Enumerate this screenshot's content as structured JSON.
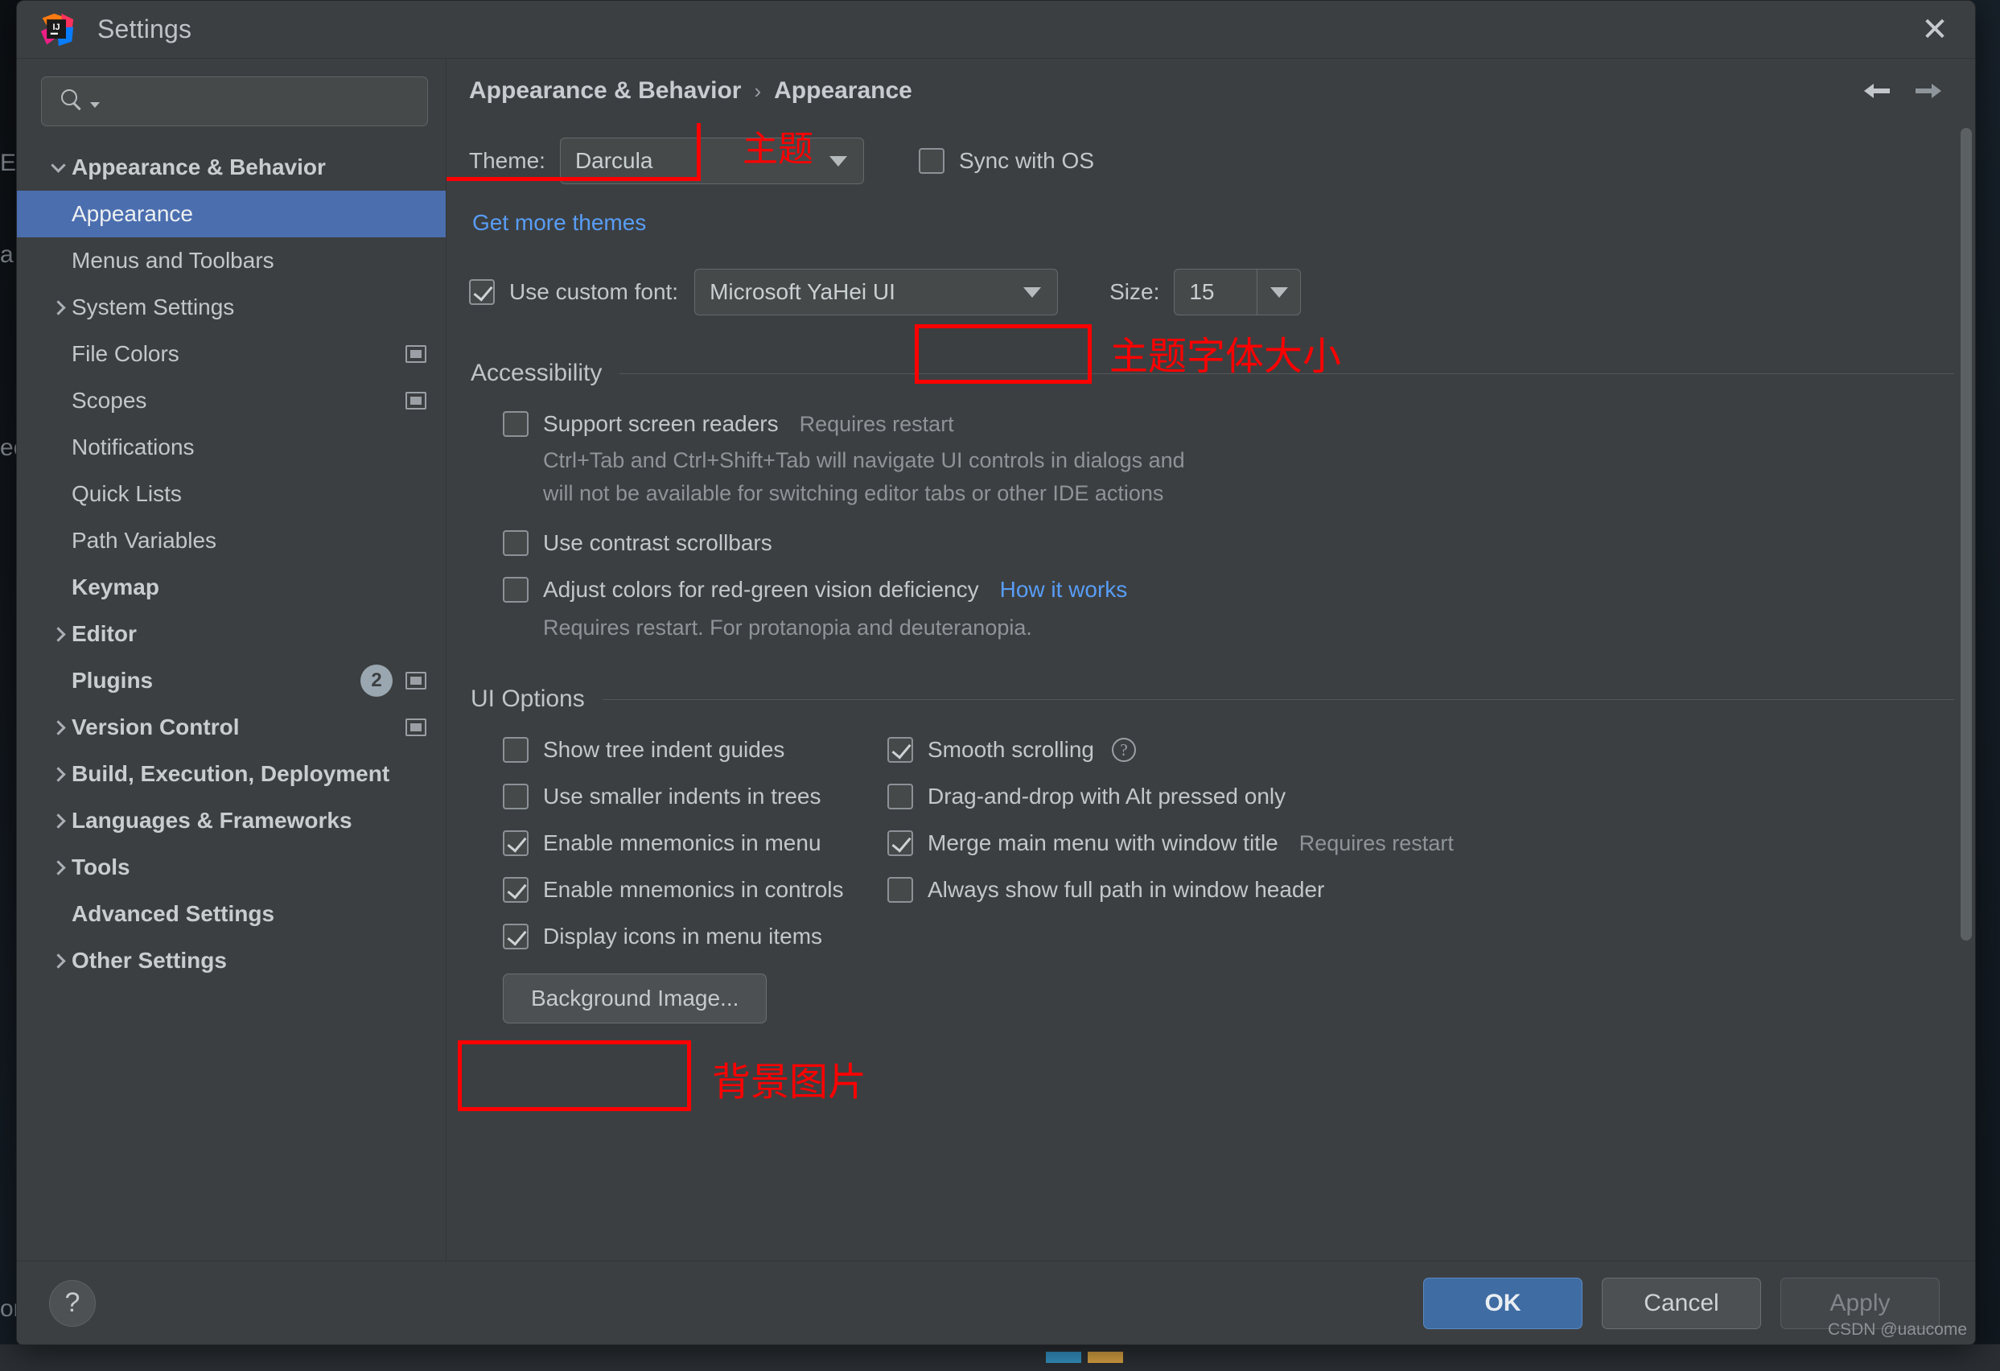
{
  "window": {
    "title": "Settings",
    "app_icon": "intellij-idea-icon",
    "close_icon": "close-icon"
  },
  "sidebar": {
    "search": {
      "placeholder": "",
      "value": "",
      "icon": "search-icon"
    },
    "items": [
      {
        "label": "Appearance & Behavior",
        "level": 0,
        "bold": true,
        "arrow": "down",
        "selected": false,
        "badge": "",
        "project_icon": false
      },
      {
        "label": "Appearance",
        "level": 1,
        "bold": false,
        "arrow": "none",
        "selected": true,
        "badge": "",
        "project_icon": false
      },
      {
        "label": "Menus and Toolbars",
        "level": 1,
        "bold": false,
        "arrow": "none",
        "selected": false,
        "badge": "",
        "project_icon": false
      },
      {
        "label": "System Settings",
        "level": 1,
        "bold": false,
        "arrow": "right",
        "selected": false,
        "badge": "",
        "project_icon": false
      },
      {
        "label": "File Colors",
        "level": 1,
        "bold": false,
        "arrow": "none",
        "selected": false,
        "badge": "",
        "project_icon": true
      },
      {
        "label": "Scopes",
        "level": 1,
        "bold": false,
        "arrow": "none",
        "selected": false,
        "badge": "",
        "project_icon": true
      },
      {
        "label": "Notifications",
        "level": 1,
        "bold": false,
        "arrow": "none",
        "selected": false,
        "badge": "",
        "project_icon": false
      },
      {
        "label": "Quick Lists",
        "level": 1,
        "bold": false,
        "arrow": "none",
        "selected": false,
        "badge": "",
        "project_icon": false
      },
      {
        "label": "Path Variables",
        "level": 1,
        "bold": false,
        "arrow": "none",
        "selected": false,
        "badge": "",
        "project_icon": false
      },
      {
        "label": "Keymap",
        "level": 0,
        "bold": true,
        "arrow": "none",
        "selected": false,
        "badge": "",
        "project_icon": false
      },
      {
        "label": "Editor",
        "level": 0,
        "bold": true,
        "arrow": "right",
        "selected": false,
        "badge": "",
        "project_icon": false
      },
      {
        "label": "Plugins",
        "level": 0,
        "bold": true,
        "arrow": "none",
        "selected": false,
        "badge": "2",
        "project_icon": true
      },
      {
        "label": "Version Control",
        "level": 0,
        "bold": true,
        "arrow": "right",
        "selected": false,
        "badge": "",
        "project_icon": true
      },
      {
        "label": "Build, Execution, Deployment",
        "level": 0,
        "bold": true,
        "arrow": "right",
        "selected": false,
        "badge": "",
        "project_icon": false
      },
      {
        "label": "Languages & Frameworks",
        "level": 0,
        "bold": true,
        "arrow": "right",
        "selected": false,
        "badge": "",
        "project_icon": false
      },
      {
        "label": "Tools",
        "level": 0,
        "bold": true,
        "arrow": "right",
        "selected": false,
        "badge": "",
        "project_icon": false
      },
      {
        "label": "Advanced Settings",
        "level": 0,
        "bold": true,
        "arrow": "none",
        "selected": false,
        "badge": "",
        "project_icon": false
      },
      {
        "label": "Other Settings",
        "level": 0,
        "bold": true,
        "arrow": "right",
        "selected": false,
        "badge": "",
        "project_icon": false
      }
    ]
  },
  "content": {
    "breadcrumb": {
      "parent": "Appearance & Behavior",
      "separator": "›",
      "current": "Appearance"
    },
    "nav": {
      "back_icon": "arrow-left-icon",
      "forward_icon": "arrow-right-icon"
    },
    "theme": {
      "label": "Theme:",
      "value": "Darcula",
      "sync_with_os_label": "Sync with OS",
      "sync_with_os_checked": false,
      "get_more_themes": "Get more themes"
    },
    "font": {
      "use_custom_font_label": "Use custom font:",
      "use_custom_font_checked": true,
      "font_value": "Microsoft YaHei UI",
      "size_label": "Size:",
      "size_value": "15"
    },
    "accessibility": {
      "title": "Accessibility",
      "screen_readers_label": "Support screen readers",
      "screen_readers_checked": false,
      "screen_readers_restart": "Requires restart",
      "screen_readers_hint_line1": "Ctrl+Tab and Ctrl+Shift+Tab will navigate UI controls in dialogs and",
      "screen_readers_hint_line2": "will not be available for switching editor tabs or other IDE actions",
      "contrast_scrollbars_label": "Use contrast scrollbars",
      "contrast_scrollbars_checked": false,
      "red_green_label": "Adjust colors for red-green vision deficiency",
      "red_green_checked": false,
      "how_it_works": "How it works",
      "red_green_hint": "Requires restart. For protanopia and deuteranopia."
    },
    "ui_options": {
      "title": "UI Options",
      "left": [
        {
          "label": "Show tree indent guides",
          "checked": false
        },
        {
          "label": "Use smaller indents in trees",
          "checked": false
        },
        {
          "label": "Enable mnemonics in menu",
          "checked": true
        },
        {
          "label": "Enable mnemonics in controls",
          "checked": true
        },
        {
          "label": "Display icons in menu items",
          "checked": true
        }
      ],
      "right": [
        {
          "label": "Smooth scrolling",
          "checked": true,
          "help": true,
          "restart": ""
        },
        {
          "label": "Drag-and-drop with Alt pressed only",
          "checked": false,
          "help": false,
          "restart": ""
        },
        {
          "label": "Merge main menu with window title",
          "checked": true,
          "help": false,
          "restart": "Requires restart"
        },
        {
          "label": "Always show full path in window header",
          "checked": false,
          "help": false,
          "restart": ""
        }
      ],
      "background_image_button": "Background Image..."
    }
  },
  "annotations": [
    {
      "name": "theme-annotation",
      "text": "主题",
      "color": "#ff0000"
    },
    {
      "name": "font-size-annotation",
      "text": "主题字体大小",
      "color": "#ff0000"
    },
    {
      "name": "background-image-annotation",
      "text": "背景图片",
      "color": "#ff0000"
    }
  ],
  "footer": {
    "help_label": "?",
    "ok": "OK",
    "cancel": "Cancel",
    "apply": "Apply"
  },
  "watermark": "CSDN @uaucome",
  "backdrop": {
    "left_fragment_1": "E",
    "left_fragment_2": "a",
    "left_fragment_3": "ec",
    "left_fragment_4": "on"
  }
}
